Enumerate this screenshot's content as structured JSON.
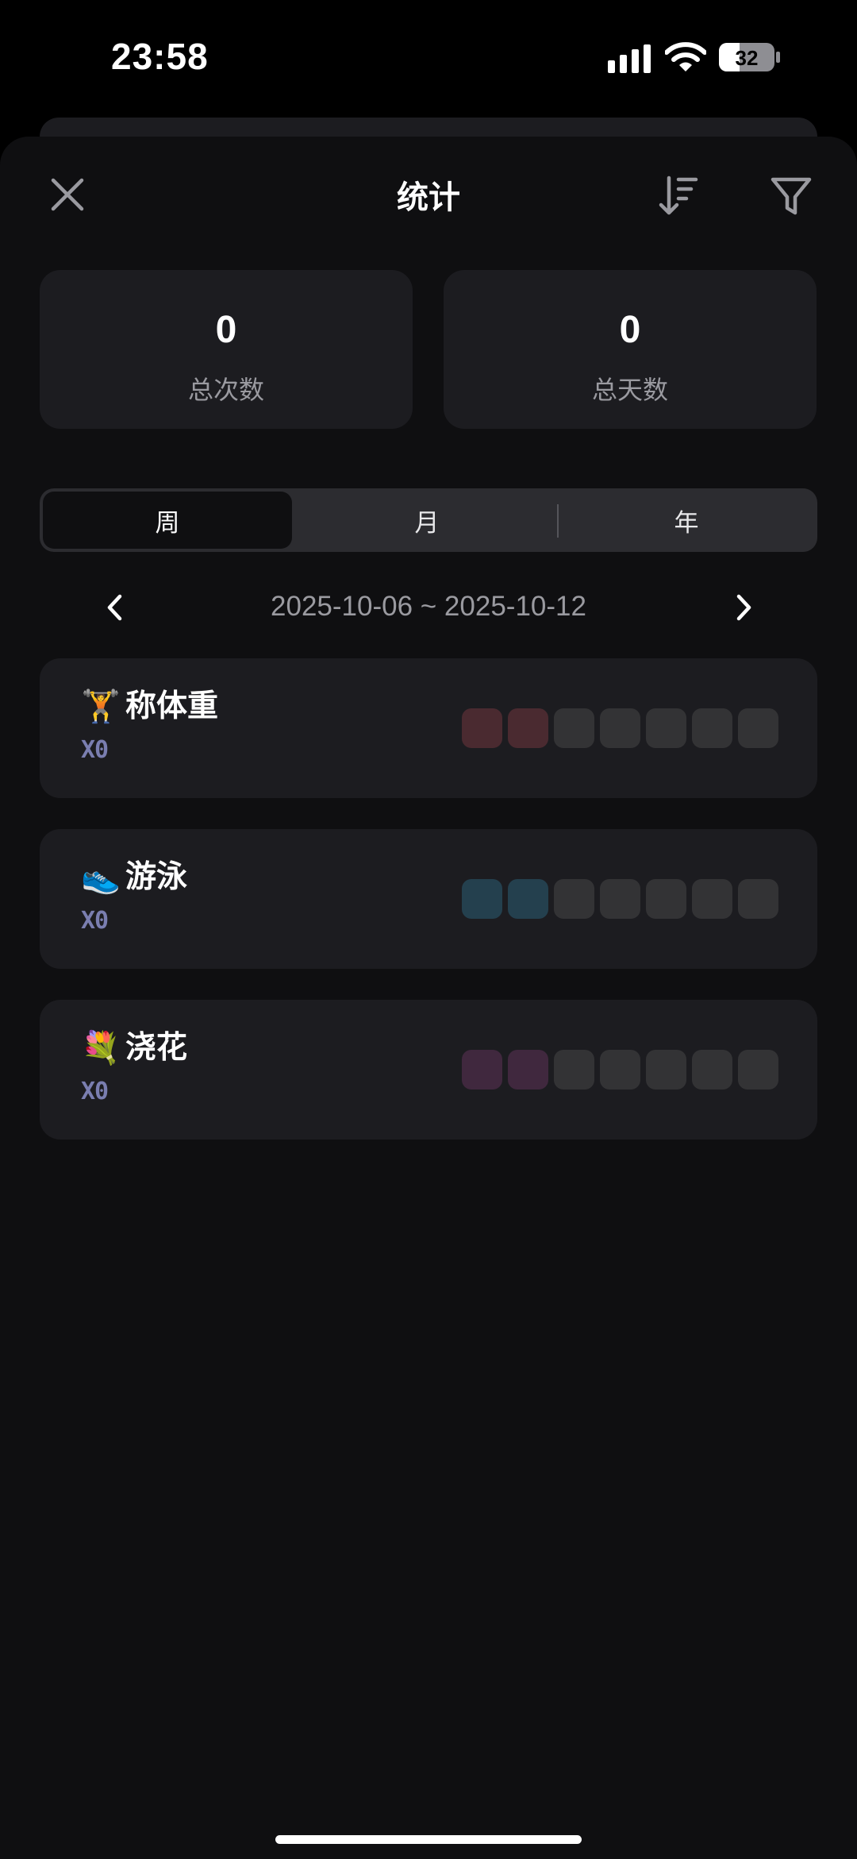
{
  "status_bar": {
    "time": "23:58",
    "battery": "32"
  },
  "header": {
    "title": "统计"
  },
  "stats": {
    "total_times_value": "0",
    "total_times_label": "总次数",
    "total_days_value": "0",
    "total_days_label": "总天数"
  },
  "segments": {
    "week": "周",
    "month": "月",
    "year": "年",
    "selected": "周"
  },
  "date_range": "2025-10-06 ~ 2025-10-12",
  "habits": [
    {
      "emoji": "🏋️",
      "name": "称体重",
      "count": "X0",
      "color": "#4a2a30",
      "highlighted_days": 2
    },
    {
      "emoji": "👟",
      "name": "游泳",
      "count": "X0",
      "color": "#24404e",
      "highlighted_days": 2
    },
    {
      "emoji": "💐",
      "name": "浇花",
      "count": "X0",
      "color": "#40283e",
      "highlighted_days": 2
    }
  ],
  "colors": {
    "background": "#0f0f11",
    "card": "#1c1c20",
    "empty_day": "#333335",
    "count_text": "#7a7eb0"
  }
}
